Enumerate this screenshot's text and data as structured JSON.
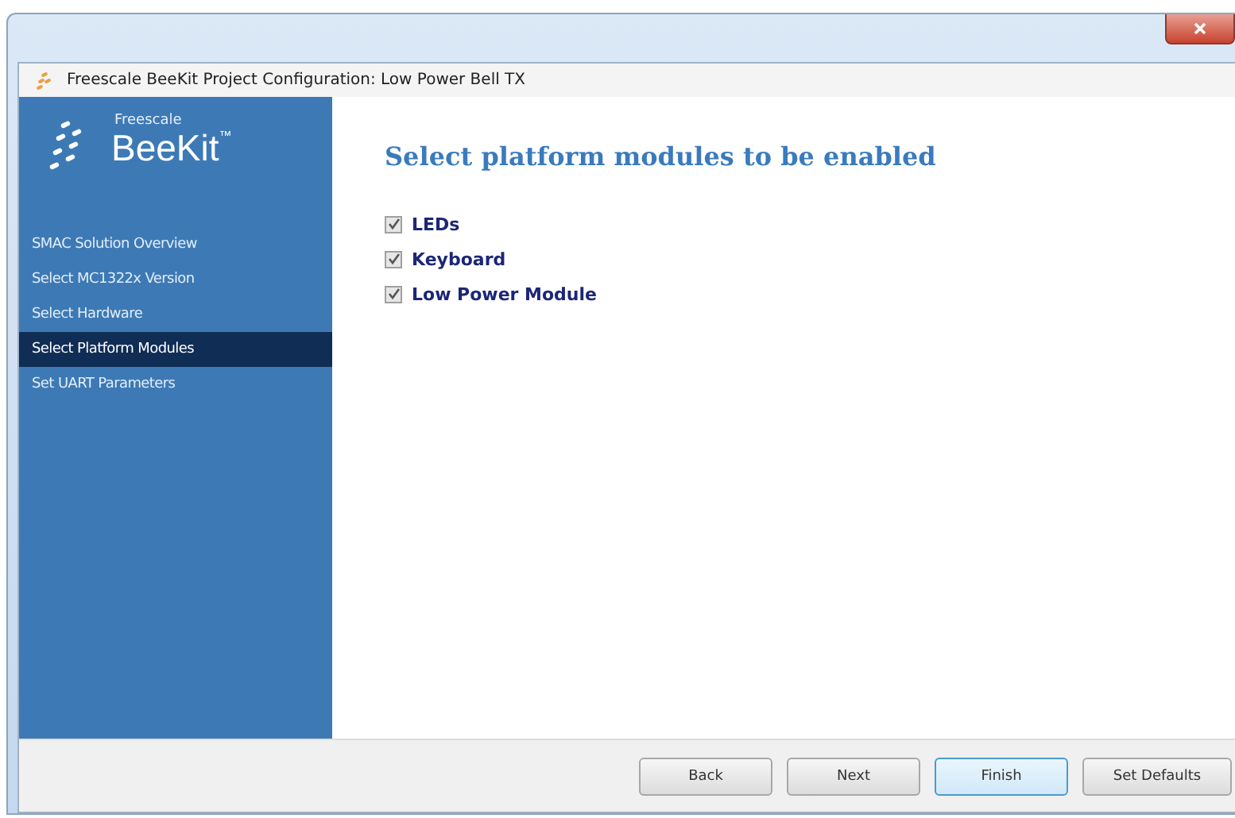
{
  "window": {
    "title": "Freescale BeeKit Project Configuration: Low Power Bell TX"
  },
  "logo": {
    "brand": "Freescale",
    "product": "BeeKit",
    "mark": "™"
  },
  "sidebar": {
    "items": [
      {
        "label": "SMAC Solution Overview",
        "selected": false
      },
      {
        "label": "Select MC1322x Version",
        "selected": false
      },
      {
        "label": "Select Hardware",
        "selected": false
      },
      {
        "label": "Select Platform Modules",
        "selected": true
      },
      {
        "label": "Set UART Parameters",
        "selected": false
      }
    ]
  },
  "content": {
    "heading": "Select platform modules to be enabled",
    "modules": [
      {
        "label": "LEDs",
        "checked": true
      },
      {
        "label": "Keyboard",
        "checked": true
      },
      {
        "label": "Low Power Module",
        "checked": true
      }
    ]
  },
  "buttons": [
    {
      "label": "Back",
      "focused": false
    },
    {
      "label": "Next",
      "focused": false
    },
    {
      "label": "Finish",
      "focused": true
    },
    {
      "label": "Set Defaults",
      "focused": false
    }
  ]
}
